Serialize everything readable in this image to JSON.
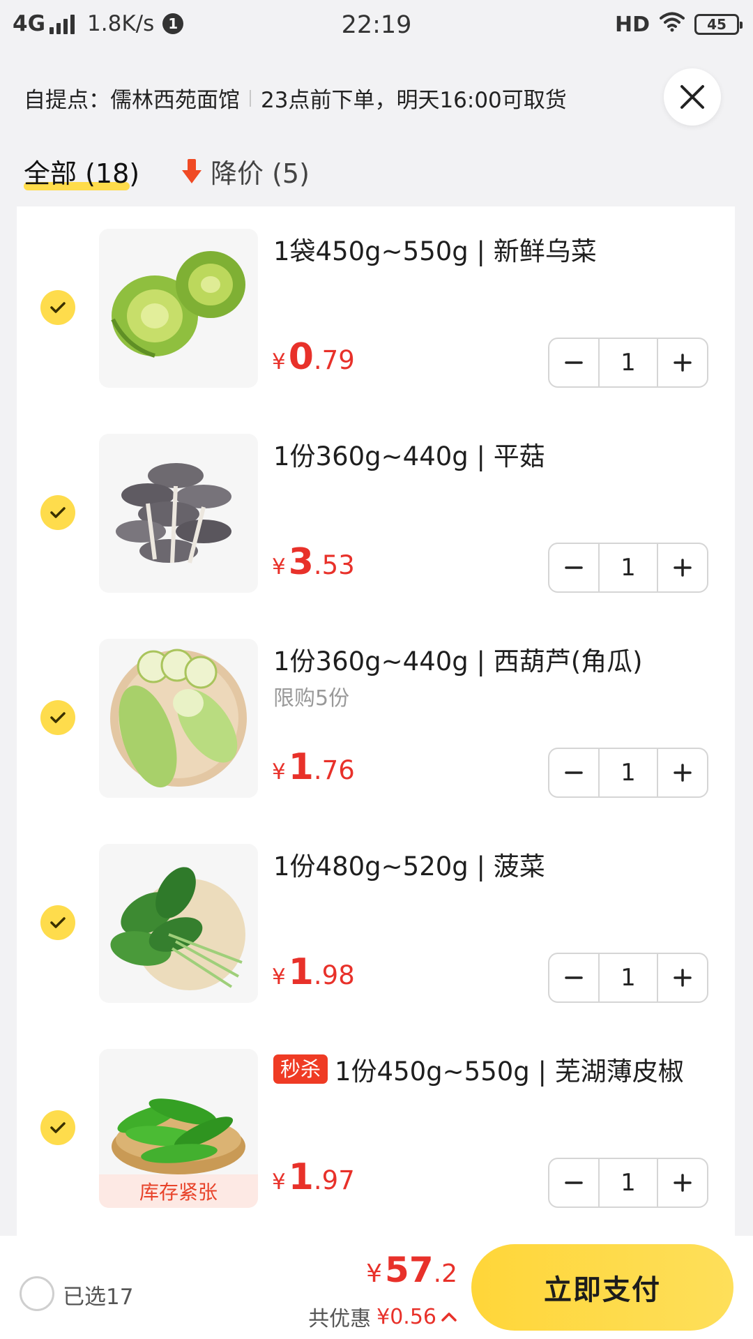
{
  "status_bar": {
    "network": "4G",
    "speed": "1.8K/s",
    "notification_count": "1",
    "time": "22:19",
    "hd": "HD",
    "battery": "45"
  },
  "pickup": {
    "location": "自提点：儒林西苑面馆",
    "schedule": "23点前下单，明天16:00可取货"
  },
  "tabs": {
    "all": "全部 (18)",
    "price_drop": "降价 (5)"
  },
  "items": [
    {
      "title": "1袋450g~550g | 新鲜乌菜",
      "tag": "",
      "limit": "",
      "stock_note": "",
      "price_symbol": "¥",
      "price_int": "0",
      "price_dec": ".79",
      "quantity": "1",
      "checked": true,
      "image_icon": "cabbage-icon"
    },
    {
      "title": "1份360g~440g | 平菇",
      "tag": "",
      "limit": "",
      "stock_note": "",
      "price_symbol": "¥",
      "price_int": "3",
      "price_dec": ".53",
      "quantity": "1",
      "checked": true,
      "image_icon": "mushroom-icon"
    },
    {
      "title": "1份360g~440g | 西葫芦(角瓜)",
      "tag": "",
      "limit": "限购5份",
      "stock_note": "",
      "price_symbol": "¥",
      "price_int": "1",
      "price_dec": ".76",
      "quantity": "1",
      "checked": true,
      "image_icon": "zucchini-icon"
    },
    {
      "title": "1份480g~520g | 菠菜",
      "tag": "",
      "limit": "",
      "stock_note": "",
      "price_symbol": "¥",
      "price_int": "1",
      "price_dec": ".98",
      "quantity": "1",
      "checked": true,
      "image_icon": "spinach-icon"
    },
    {
      "title": "1份450g~550g | 芜湖薄皮椒",
      "tag": "秒杀",
      "limit": "",
      "stock_note": "库存紧张",
      "price_symbol": "¥",
      "price_int": "1",
      "price_dec": ".97",
      "quantity": "1",
      "checked": true,
      "image_icon": "pepper-icon"
    }
  ],
  "bottom_bar": {
    "selected": "已选17",
    "total_symbol": "¥",
    "total_int": "57",
    "total_dec": ".2",
    "discount_label": "共优惠",
    "discount_amount": "¥0.56",
    "pay_button": "立即支付"
  },
  "colors": {
    "accent_yellow": "#fedc4c",
    "price_red": "#e8312a",
    "background": "#f2f2f4"
  }
}
